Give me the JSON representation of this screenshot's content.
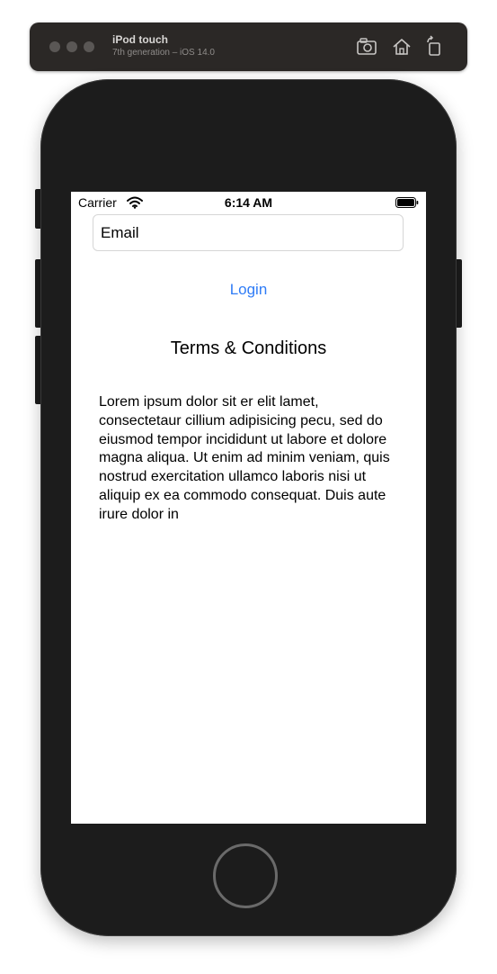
{
  "simulator": {
    "device_name": "iPod touch",
    "device_subtitle": "7th generation – iOS 14.0",
    "icons": [
      "screenshot-icon",
      "home-icon",
      "rotate-icon"
    ]
  },
  "status_bar": {
    "carrier": "Carrier",
    "time": "6:14 AM",
    "icons": [
      "wifi-icon",
      "battery-icon"
    ]
  },
  "form": {
    "email_placeholder": "Email",
    "email_value": "",
    "login_label": "Login"
  },
  "terms": {
    "title": "Terms & Conditions",
    "body": "Lorem ipsum dolor sit er elit lamet, consectetaur cillium adipisicing pecu, sed do eiusmod tempor incididunt ut labore et dolore magna aliqua. Ut enim ad minim veniam, quis nostrud exercitation ullamco laboris nisi ut aliquip ex ea commodo consequat. Duis aute irure dolor in"
  },
  "colors": {
    "link": "#2f7cf6",
    "device": "#1c1c1c",
    "sim_bar": "#2b2826"
  }
}
